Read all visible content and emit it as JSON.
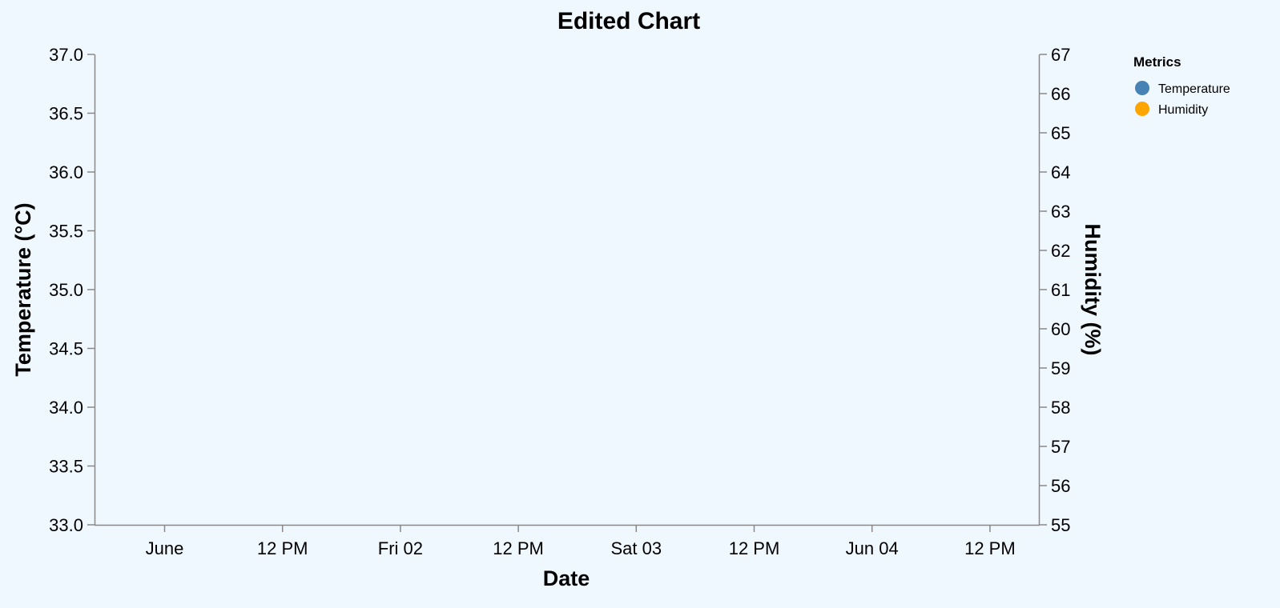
{
  "chart_data": {
    "type": "line",
    "title": "Edited Chart",
    "xlabel": "Date",
    "ylabel_left": "Temperature (°C)",
    "ylabel_right": "Humidity (%)",
    "x_ticks": [
      "June",
      "12 PM",
      "Fri 02",
      "12 PM",
      "Sat 03",
      "12 PM",
      "Jun 04",
      "12 PM"
    ],
    "y_left": {
      "lim": [
        33.0,
        37.0
      ],
      "ticks": [
        "33.0",
        "33.5",
        "34.0",
        "34.5",
        "35.0",
        "35.5",
        "36.0",
        "36.5",
        "37.0"
      ]
    },
    "y_right": {
      "lim": [
        55,
        67
      ],
      "ticks": [
        "55",
        "56",
        "57",
        "58",
        "59",
        "60",
        "61",
        "62",
        "63",
        "64",
        "65",
        "66",
        "67"
      ]
    },
    "grid": false,
    "legend": {
      "title": "Metrics",
      "placement": "top-right",
      "items": [
        {
          "label": "Temperature",
          "color": "#4682b4"
        },
        {
          "label": "Humidity",
          "color": "#ffa500"
        }
      ]
    },
    "series": [
      {
        "name": "Temperature",
        "axis": "left",
        "color": "#4682b4",
        "values": []
      },
      {
        "name": "Humidity",
        "axis": "right",
        "color": "#ffa500",
        "values": []
      }
    ]
  }
}
